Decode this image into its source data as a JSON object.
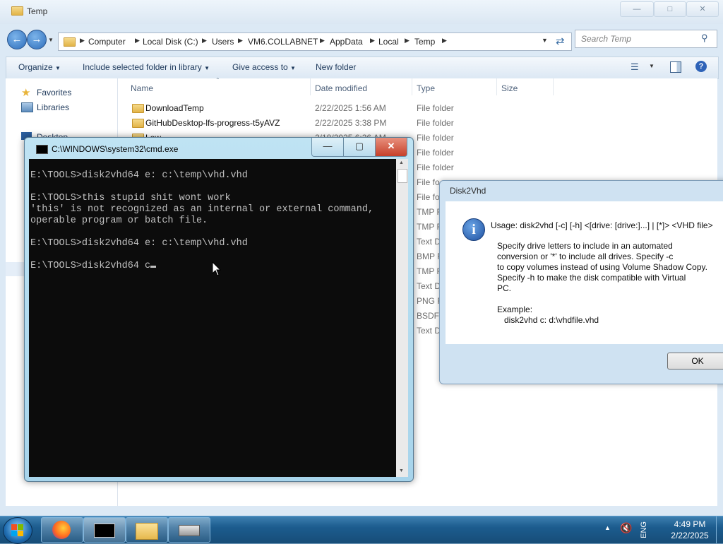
{
  "explorer": {
    "title": "Temp",
    "search_placeholder": "Search Temp",
    "breadcrumb": [
      "Computer",
      "Local Disk (C:)",
      "Users",
      "VM6.COLLABNET",
      "AppData",
      "Local",
      "Temp"
    ],
    "commands": [
      "Organize",
      "Include selected folder in library",
      "Give access to",
      "New folder"
    ],
    "nav": {
      "favorites": "Favorites",
      "libraries": "Libraries",
      "desktop": "Desktop"
    },
    "columns": {
      "name": "Name",
      "date": "Date modified",
      "type": "Type",
      "size": "Size"
    },
    "rows": [
      {
        "name": "DownloadTemp",
        "date": "2/22/2025 1:56 AM",
        "type": "File folder"
      },
      {
        "name": "GitHubDesktop-lfs-progress-t5yAVZ",
        "date": "2/22/2025 3:38 PM",
        "type": "File folder"
      },
      {
        "name": "Low",
        "date": "2/18/2025 6:26 AM",
        "type": "File folder"
      },
      {
        "name": "",
        "date": "",
        "type": "File folder"
      },
      {
        "name": "",
        "date": "",
        "type": "File folder"
      },
      {
        "name": "",
        "date": "",
        "type": "File fo"
      },
      {
        "name": "",
        "date": "",
        "type": "File fo"
      },
      {
        "name": "",
        "date": "",
        "type": "TMP F"
      },
      {
        "name": "",
        "date": "",
        "type": "TMP F"
      },
      {
        "name": "",
        "date": "",
        "type": "Text D"
      },
      {
        "name": "",
        "date": "",
        "type": "BMP F"
      },
      {
        "name": "",
        "date": "",
        "type": "TMP F"
      },
      {
        "name": "",
        "date": "",
        "type": "Text D"
      },
      {
        "name": "",
        "date": "",
        "type": "PNG F"
      },
      {
        "name": "",
        "date": "",
        "type": "BSDF"
      },
      {
        "name": "",
        "date": "",
        "type": "Text D"
      }
    ]
  },
  "cmd": {
    "title": "C:\\WINDOWS\\system32\\cmd.exe",
    "lines": [
      "E:\\TOOLS>disk2vhd64 e: c:\\temp\\vhd.vhd",
      "",
      "E:\\TOOLS>this stupid shit wont work",
      "'this' is not recognized as an internal or external command,",
      "operable program or batch file.",
      "",
      "E:\\TOOLS>disk2vhd64 e: c:\\temp\\vhd.vhd",
      "",
      "E:\\TOOLS>disk2vhd64 c"
    ]
  },
  "dialog": {
    "title": "Disk2Vhd",
    "usage": "Usage: disk2vhd [-c] [-h] <[drive: [drive:]...] | [*]> <VHD file>",
    "body": "Specify drive letters to include in an automated\nconversion or '*' to include all drives. Specify -c\nto copy volumes instead of using Volume Shadow Copy.\nSpecify -h to make the disk compatible with Virtual\nPC.\n\nExample:\n   disk2vhd c: d:\\vhdfile.vhd",
    "ok_label": "OK"
  },
  "taskbar": {
    "time": "4:49 PM",
    "date": "2/22/2025",
    "language": "ENG"
  }
}
